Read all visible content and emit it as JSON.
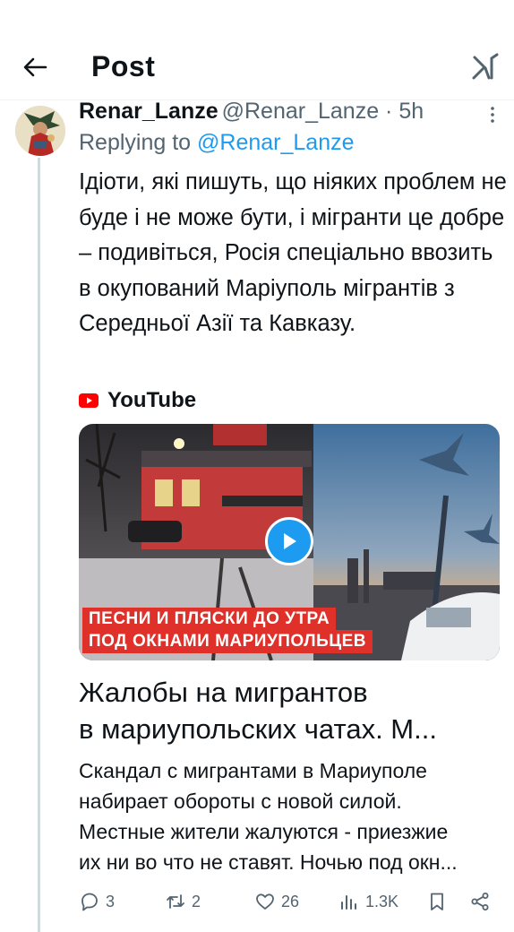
{
  "header": {
    "title": "Post",
    "back_icon": "arrow-left-icon",
    "brand_icon": "x-grok-logo-icon"
  },
  "tweet": {
    "display_name": "Renar_Lanze",
    "handle_time": "@Renar_Lanze · 5h",
    "replying_prefix": "Replying to",
    "replying_to": "@Renar_Lanze",
    "text": "Ідіоти, які пишуть, що ніяких проблем не буде і не може бути, і мігранти це добре – подивіться, Росія спеціально ввозить в окупований Маріуполь мігрантів з Середньої Азії та Кавказу."
  },
  "card": {
    "source": "YouTube",
    "banner_line1": "ПЕСНИ И ПЛЯСКИ ДО УТРА",
    "banner_line2": "ПОД ОКНАМИ МАРИУПОЛЬЦЕВ",
    "title": "Жалобы на мигрантов\nв мариупольских чатах. М...",
    "description": "Скандал с мигрантами в Мариуполе\nнабирает обороты с новой силой.\nМестные жители жалуются - приезжие\nих ни во что не ставят. Ночью под окн..."
  },
  "actions": {
    "replies": "3",
    "reposts": "2",
    "likes": "26",
    "views": "1.3K"
  },
  "colors": {
    "accent": "#1d9bf0",
    "secondary_text": "#536471",
    "banner_red": "#e0302a",
    "youtube_red": "#ff0000"
  }
}
